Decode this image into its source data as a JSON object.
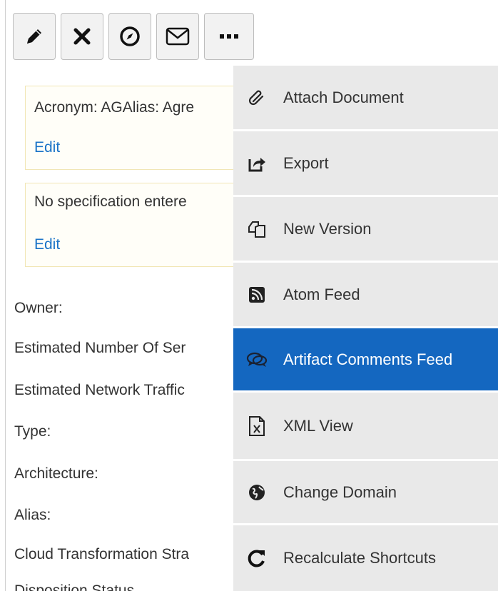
{
  "toolbar": {
    "buttons": [
      {
        "name": "edit",
        "icon": "pencil-icon"
      },
      {
        "name": "delete",
        "icon": "close-icon"
      },
      {
        "name": "navigate",
        "icon": "compass-icon"
      },
      {
        "name": "email",
        "icon": "envelope-icon"
      },
      {
        "name": "more",
        "icon": "more-dots-icon"
      }
    ]
  },
  "cards": [
    {
      "text": "Acronym: AGAlias: Agre",
      "edit_label": "Edit"
    },
    {
      "text": "No specification entere",
      "edit_label": "Edit"
    }
  ],
  "fields": [
    "Owner:",
    "Estimated Number Of Ser",
    "Estimated Network Traffic",
    "Type:",
    "Architecture:",
    "Alias:",
    "Cloud Transformation Stra",
    "Disposition Status"
  ],
  "menu": {
    "items": [
      {
        "label": "Attach Document",
        "icon": "paperclip-icon"
      },
      {
        "label": "Export",
        "icon": "share-export-icon"
      },
      {
        "label": "New Version",
        "icon": "copy-versions-icon"
      },
      {
        "label": "Atom Feed",
        "icon": "rss-feed-icon"
      },
      {
        "label": "Artifact Comments Feed",
        "icon": "comments-icon",
        "active": true
      },
      {
        "label": "XML View",
        "icon": "xml-file-icon"
      },
      {
        "label": "Change Domain",
        "icon": "globe-icon"
      },
      {
        "label": "Recalculate Shortcuts",
        "icon": "refresh-icon"
      }
    ]
  },
  "colors": {
    "accent": "#1467c0",
    "link": "#1a73c7",
    "menu_bg": "#e9e9e9",
    "card_border": "#f1e6b5"
  }
}
